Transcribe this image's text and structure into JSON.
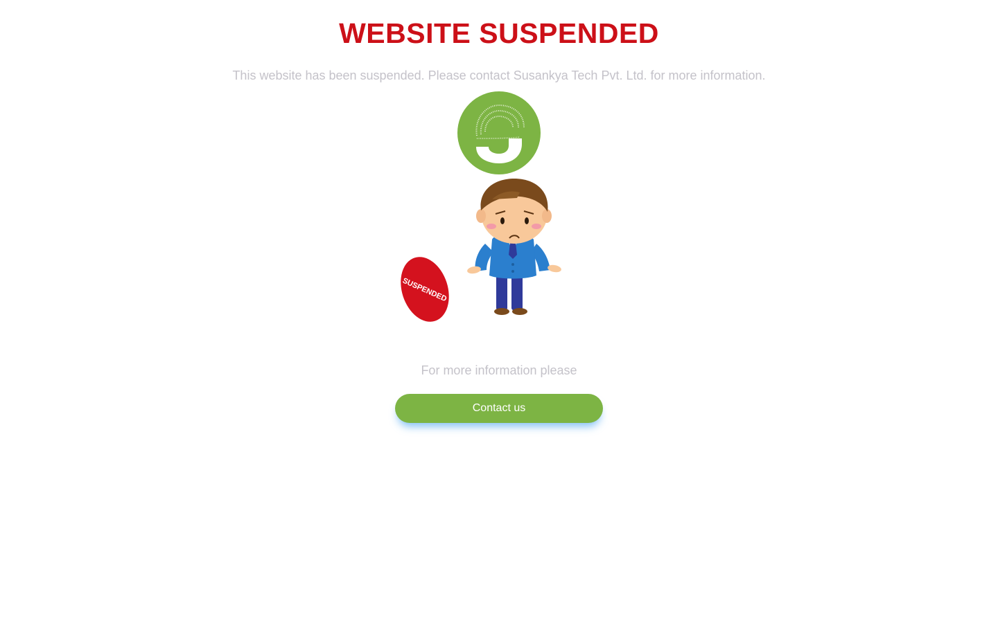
{
  "header": {
    "title": "WEBSITE SUSPENDED",
    "message": "This website has been suspended. Please contact Susankya Tech Pvt. Ltd. for more information."
  },
  "illustration": {
    "logo_icon": "susankya-logo-icon",
    "character_icon": "confused-businessman-icon",
    "stamp_text": "SUSPENDED"
  },
  "footer": {
    "more_info_text": "For more information please",
    "contact_label": "Contact us"
  },
  "colors": {
    "title_red": "#cc1018",
    "muted_text": "#c4c2c9",
    "brand_green": "#7db444",
    "button_glow": "#40a0f0",
    "stamp_red": "#d4121e"
  }
}
